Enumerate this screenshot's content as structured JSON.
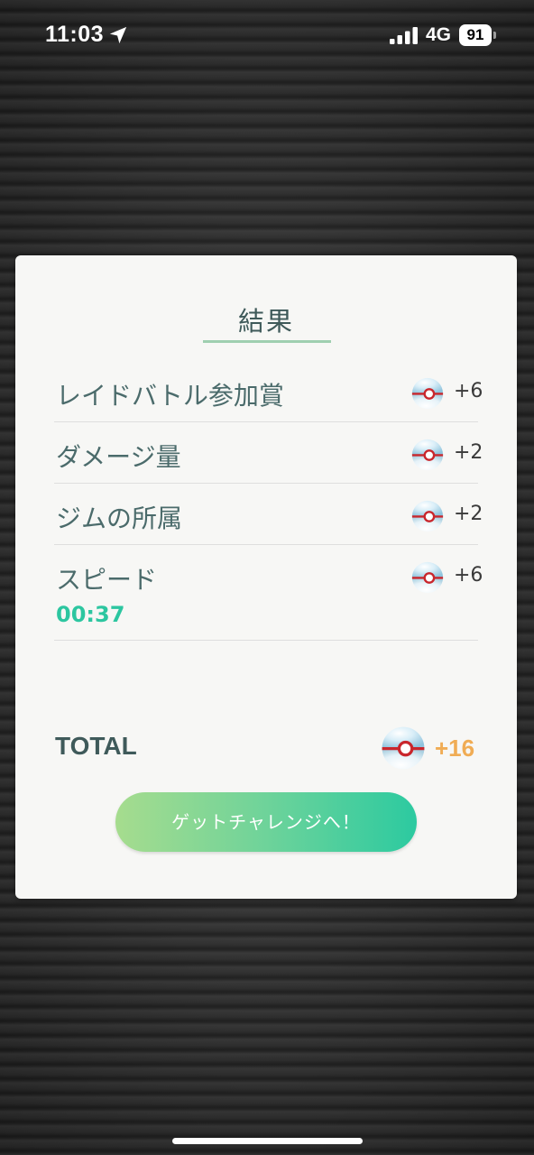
{
  "status_bar": {
    "time": "11:03",
    "network": "4G",
    "battery_level": "91"
  },
  "card": {
    "title": "結果",
    "rows": [
      {
        "label": "レイドバトル参加賞",
        "value": "+6",
        "icon": "premier-ball-icon"
      },
      {
        "label": "ダメージ量",
        "value": "+2",
        "icon": "premier-ball-icon"
      },
      {
        "label": "ジムの所属",
        "value": "+2",
        "icon": "premier-ball-icon"
      },
      {
        "label": "スピード",
        "value": "+6",
        "sublabel": "00:37",
        "icon": "premier-ball-icon"
      }
    ],
    "total_label": "TOTAL",
    "total_value": "+16",
    "button_label": "ゲットチャレンジへ！"
  },
  "colors": {
    "title_text": "#3f5a5a",
    "speed_time": "#2cc6a0",
    "total_value": "#f0ac54",
    "button_gradient_start": "#a6dc8e",
    "button_gradient_end": "#2ccaa0"
  }
}
